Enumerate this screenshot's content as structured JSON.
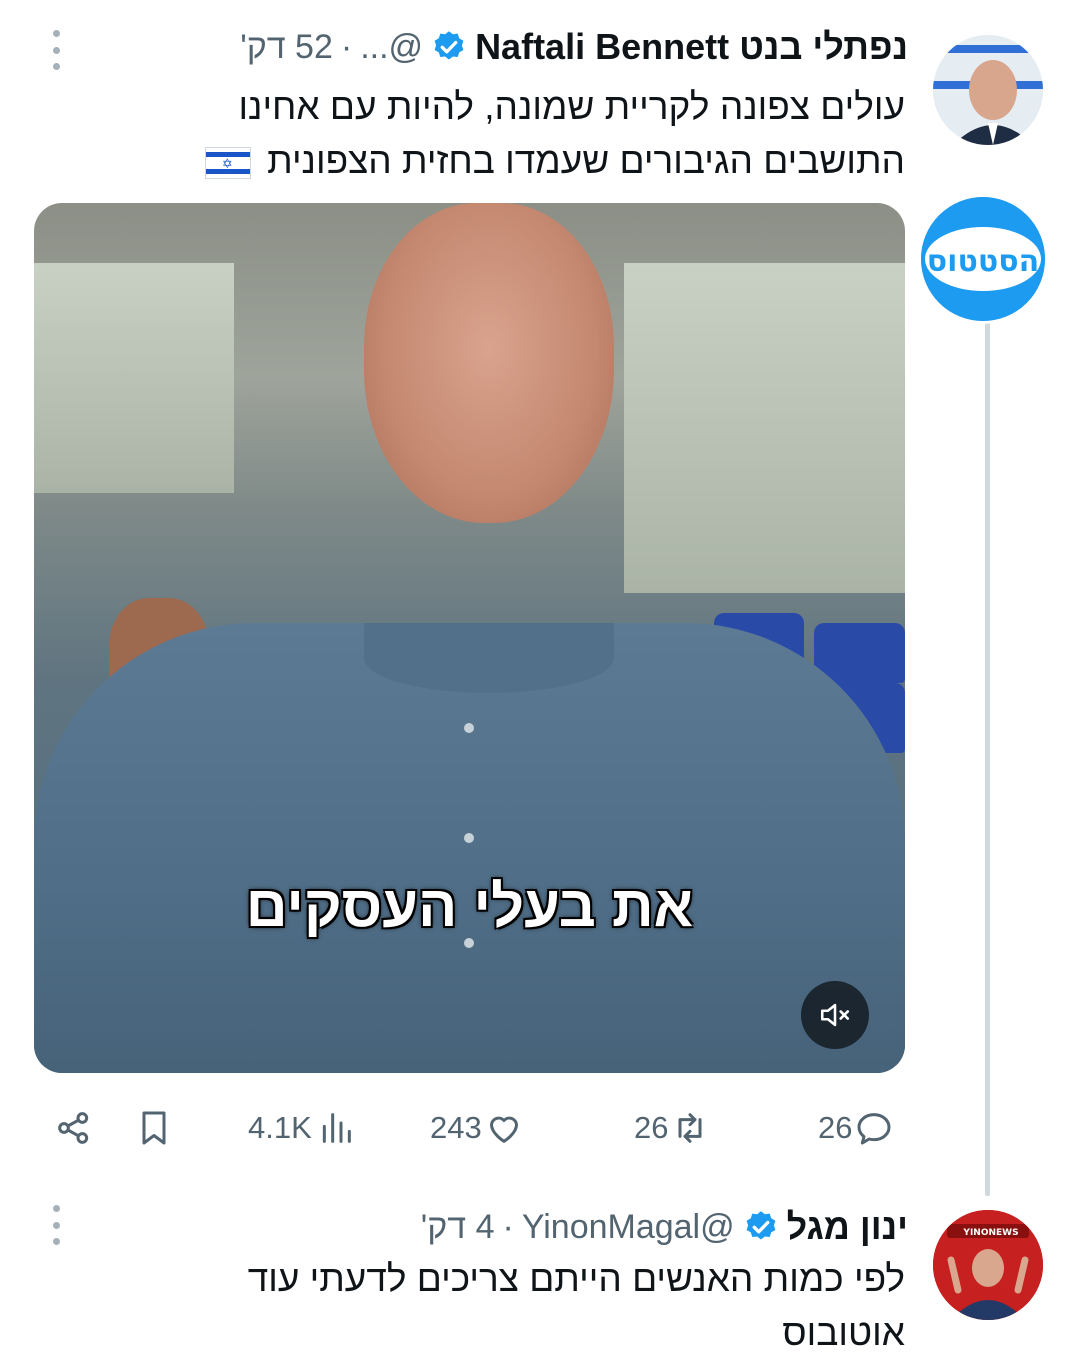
{
  "tweet1": {
    "name": "נפתלי בנט Naftali Bennett",
    "handle": "@...",
    "separator": "·",
    "time": "52 דק'",
    "text_line1": "עולים צפונה לקריית שמונה, להיות עם אחינו",
    "text_line2": "התושבים הגיבורים שעמדו בחזית הצפונית",
    "flag_icon": "israel-flag-icon",
    "video": {
      "subtitle": "את בעלי העסקים",
      "mute_icon": "speaker-muted-icon"
    },
    "badge_avatar_text": "הסטטוס",
    "actions": {
      "replies": "26",
      "retweets": "26",
      "likes": "243",
      "views": "4.1K"
    }
  },
  "tweet2": {
    "name": "ינון מגל",
    "handle": "@YinonMagal",
    "separator": "·",
    "time": "4 דק'",
    "text_line1": "לפי כמות האנשים הייתם צריכים לדעתי עוד",
    "text_line2": "אוטובוס",
    "avatar_brand": "YINONEWS"
  },
  "colors": {
    "verified": "#1d9bf0",
    "secondary_text": "#536471",
    "thread_line": "#cfd9de"
  }
}
